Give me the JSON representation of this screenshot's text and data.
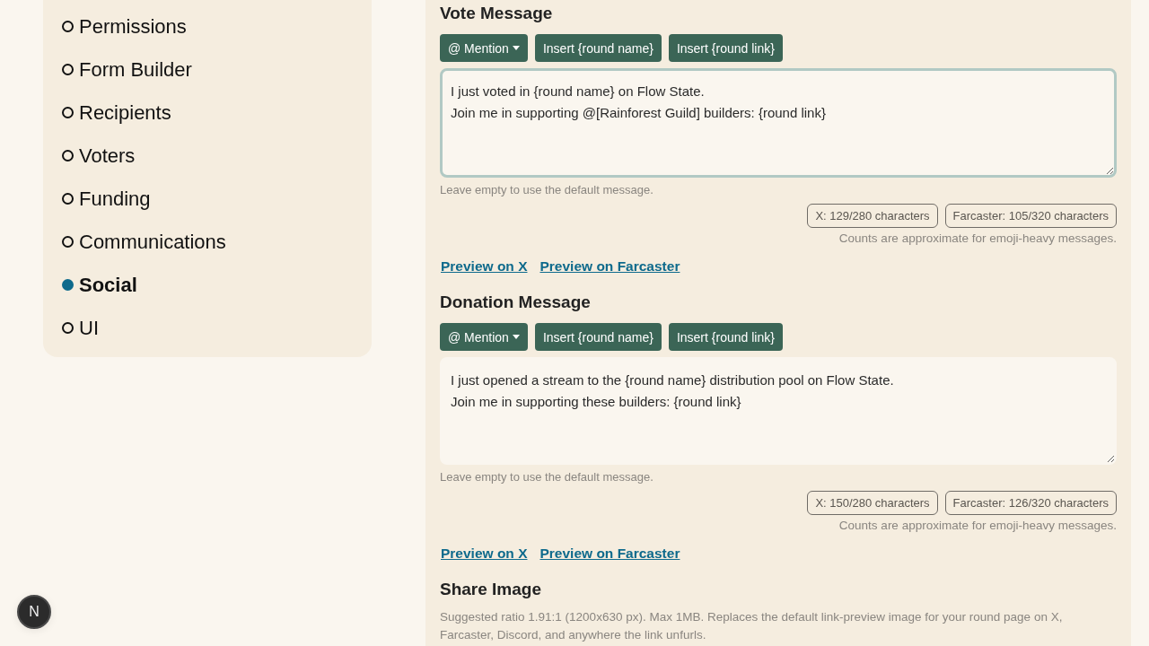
{
  "sidebar": {
    "items": [
      {
        "label": "Permissions",
        "selected": false
      },
      {
        "label": "Form Builder",
        "selected": false
      },
      {
        "label": "Recipients",
        "selected": false
      },
      {
        "label": "Voters",
        "selected": false
      },
      {
        "label": "Funding",
        "selected": false
      },
      {
        "label": "Communications",
        "selected": false
      },
      {
        "label": "Social",
        "selected": true
      },
      {
        "label": "UI",
        "selected": false
      }
    ]
  },
  "sections": [
    {
      "kind": "message",
      "title": "Vote Message",
      "toolbar": [
        {
          "kind": "dropdown",
          "label": "@ Mention"
        },
        {
          "kind": "button",
          "label": "Insert {round name}"
        },
        {
          "kind": "button",
          "label": "Insert {round link}"
        }
      ],
      "message": {
        "value": "I just voted in {round name} on Flow State.\nJoin me in supporting @[Rainforest Guild] builders: {round link}",
        "focused": true
      },
      "hint": "Leave empty to use the default message.",
      "counts": [
        "X: 129/280 characters",
        "Farcaster: 105/320 characters"
      ],
      "counts_note": "Counts are approximate for emoji-heavy messages.",
      "links": [
        "Preview on X",
        "Preview on Farcaster"
      ]
    },
    {
      "kind": "message",
      "title": "Donation Message",
      "toolbar": [
        {
          "kind": "dropdown",
          "label": "@ Mention"
        },
        {
          "kind": "button",
          "label": "Insert {round name}"
        },
        {
          "kind": "button",
          "label": "Insert {round link}"
        }
      ],
      "message": {
        "value": "I just opened a stream to the {round name} distribution pool on Flow State.\nJoin me in supporting these builders: {round link}",
        "focused": false
      },
      "hint": "Leave empty to use the default message.",
      "counts": [
        "X: 150/280 characters",
        "Farcaster: 126/320 characters"
      ],
      "counts_note": "Counts are approximate for emoji-heavy messages.",
      "links": [
        "Preview on X",
        "Preview on Farcaster"
      ]
    },
    {
      "kind": "image",
      "title": "Share Image",
      "description": "Suggested ratio 1.91:1 (1200x630 px). Max 1MB. Replaces the default link-preview image for your round page on X, Farcaster, Discord, and anywhere the link unfurls."
    }
  ],
  "dev_badge": {
    "label": "N"
  }
}
